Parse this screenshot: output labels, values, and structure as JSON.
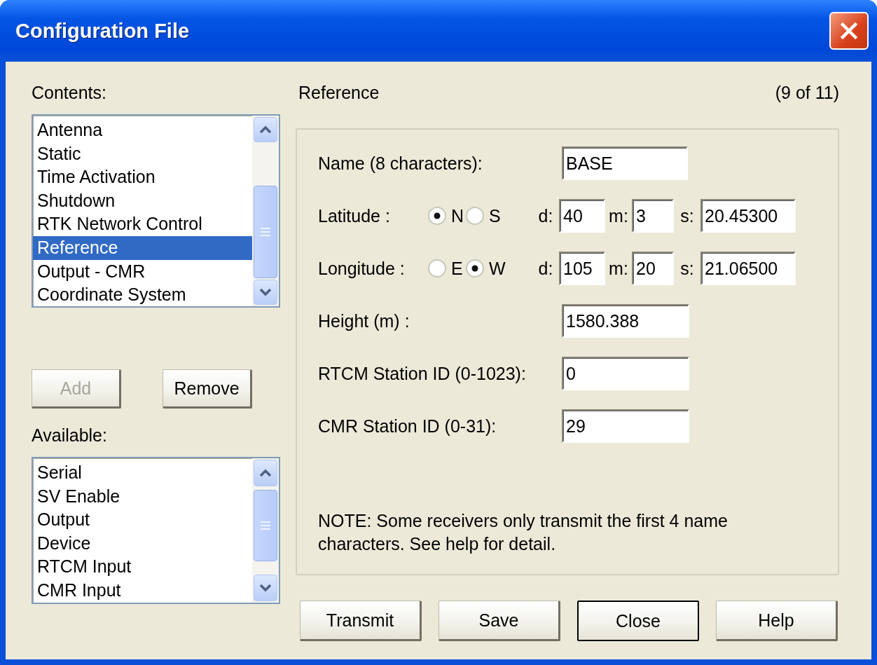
{
  "window": {
    "title": "Configuration File"
  },
  "contents": {
    "label": "Contents:",
    "items": [
      {
        "label": "Antenna",
        "selected": false
      },
      {
        "label": "Static",
        "selected": false
      },
      {
        "label": "Time Activation",
        "selected": false
      },
      {
        "label": "Shutdown",
        "selected": false
      },
      {
        "label": "RTK Network Control",
        "selected": false
      },
      {
        "label": "Reference",
        "selected": true
      },
      {
        "label": "Output - CMR",
        "selected": false
      },
      {
        "label": "Coordinate System",
        "selected": false
      }
    ]
  },
  "list_buttons": [
    {
      "label": "Add",
      "disabled": true
    },
    {
      "label": "Remove",
      "disabled": false
    }
  ],
  "available": {
    "label": "Available:",
    "items": [
      {
        "label": "Serial",
        "selected": false
      },
      {
        "label": "SV Enable",
        "selected": false
      },
      {
        "label": "Output",
        "selected": false
      },
      {
        "label": "Device",
        "selected": false
      },
      {
        "label": "RTCM Input",
        "selected": false
      },
      {
        "label": "CMR Input",
        "selected": false
      }
    ]
  },
  "section": {
    "title": "Reference",
    "counter": "(9 of 11)"
  },
  "fields": [
    {
      "kind": "text",
      "label": "Name (8 characters):",
      "value": "BASE"
    },
    {
      "kind": "coord",
      "label": "Latitude :",
      "options": [
        {
          "label": "N",
          "selected": true
        },
        {
          "label": "S",
          "selected": false
        }
      ],
      "parts": [
        {
          "label": "d:",
          "value": "40"
        },
        {
          "label": "m:",
          "value": "3"
        },
        {
          "label": "s:",
          "value": "20.45300"
        }
      ]
    },
    {
      "kind": "coord",
      "label": "Longitude :",
      "options": [
        {
          "label": "E",
          "selected": false
        },
        {
          "label": "W",
          "selected": true
        }
      ],
      "parts": [
        {
          "label": "d:",
          "value": "105"
        },
        {
          "label": "m:",
          "value": "20"
        },
        {
          "label": "s:",
          "value": "21.06500"
        }
      ]
    },
    {
      "kind": "text",
      "label": "Height (m) :",
      "value": "1580.388"
    },
    {
      "kind": "text",
      "label": "RTCM Station ID (0-1023):",
      "value": "0"
    },
    {
      "kind": "text",
      "label": "CMR Station ID (0-31):",
      "value": "29"
    }
  ],
  "note": "NOTE: Some receivers only transmit the first 4 name characters. See help for detail.",
  "buttons": [
    {
      "label": "Transmit",
      "default": false
    },
    {
      "label": "Save",
      "default": false
    },
    {
      "label": "Close",
      "default": true
    },
    {
      "label": "Help",
      "default": false
    }
  ]
}
